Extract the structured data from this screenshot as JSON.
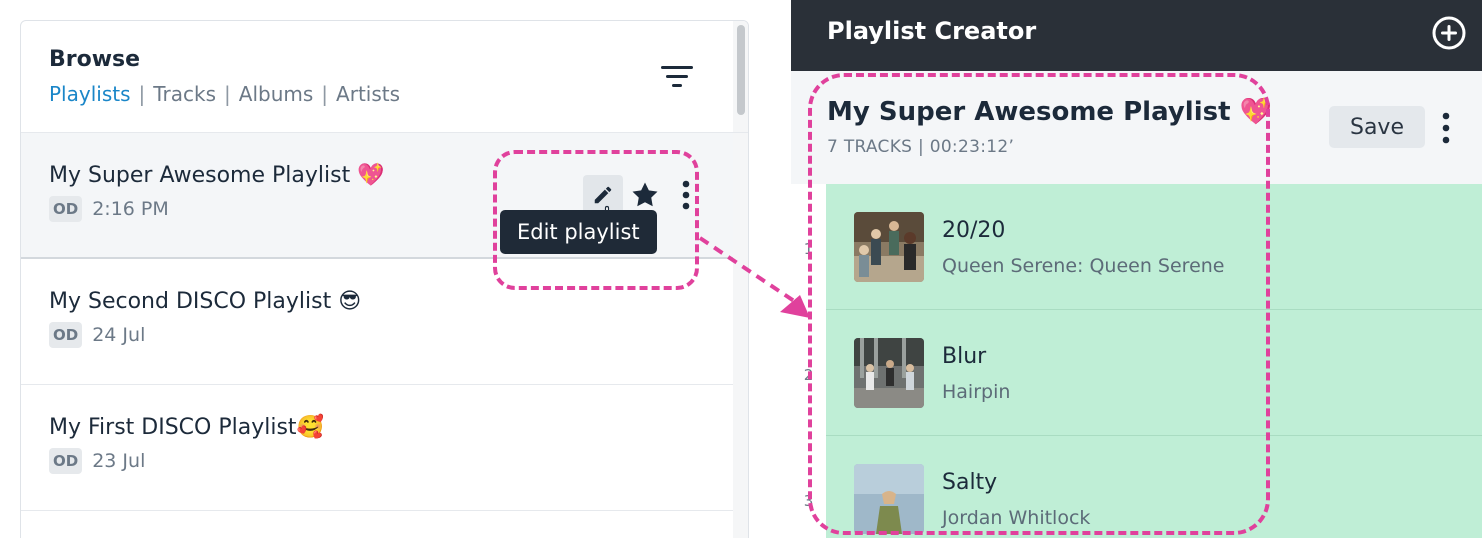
{
  "browse": {
    "title": "Browse",
    "tabs": [
      {
        "label": "Playlists",
        "active": true
      },
      {
        "label": "Tracks",
        "active": false
      },
      {
        "label": "Albums",
        "active": false
      },
      {
        "label": "Artists",
        "active": false
      }
    ],
    "separator": "|",
    "filter_icon": "filter-icon"
  },
  "playlists": [
    {
      "name": "My Super Awesome Playlist 💖",
      "owner_badge": "OD",
      "date": "2:16 PM"
    },
    {
      "name": "My Second DISCO Playlist 😎",
      "owner_badge": "OD",
      "date": "24 Jul"
    },
    {
      "name": "My First DISCO Playlist🥰",
      "owner_badge": "OD",
      "date": "23 Jul"
    }
  ],
  "row_actions": {
    "edit_icon": "pencil-icon",
    "star_icon": "star-icon",
    "more_icon": "kebab-icon",
    "tooltip": "Edit playlist"
  },
  "creator": {
    "header_title": "Playlist Creator",
    "add_icon": "plus-circle-icon",
    "playlist_title": "My Super Awesome Playlist 💖",
    "playlist_meta": "7 TRACKS | 00:23:12’",
    "save_label": "Save"
  },
  "tracks": [
    {
      "number": "1",
      "title": "20/20",
      "artist": "Queen Serene: Queen Serene"
    },
    {
      "number": "2",
      "title": "Blur",
      "artist": "Hairpin"
    },
    {
      "number": "3",
      "title": "Salty",
      "artist": "Jordan Whitlock"
    }
  ],
  "colors": {
    "accent_blue": "#1a86c8",
    "header_dark": "#2a3038",
    "track_green": "#bfeed6",
    "annotation_pink": "#e0419c",
    "tooltip_bg": "#1f2a37"
  }
}
